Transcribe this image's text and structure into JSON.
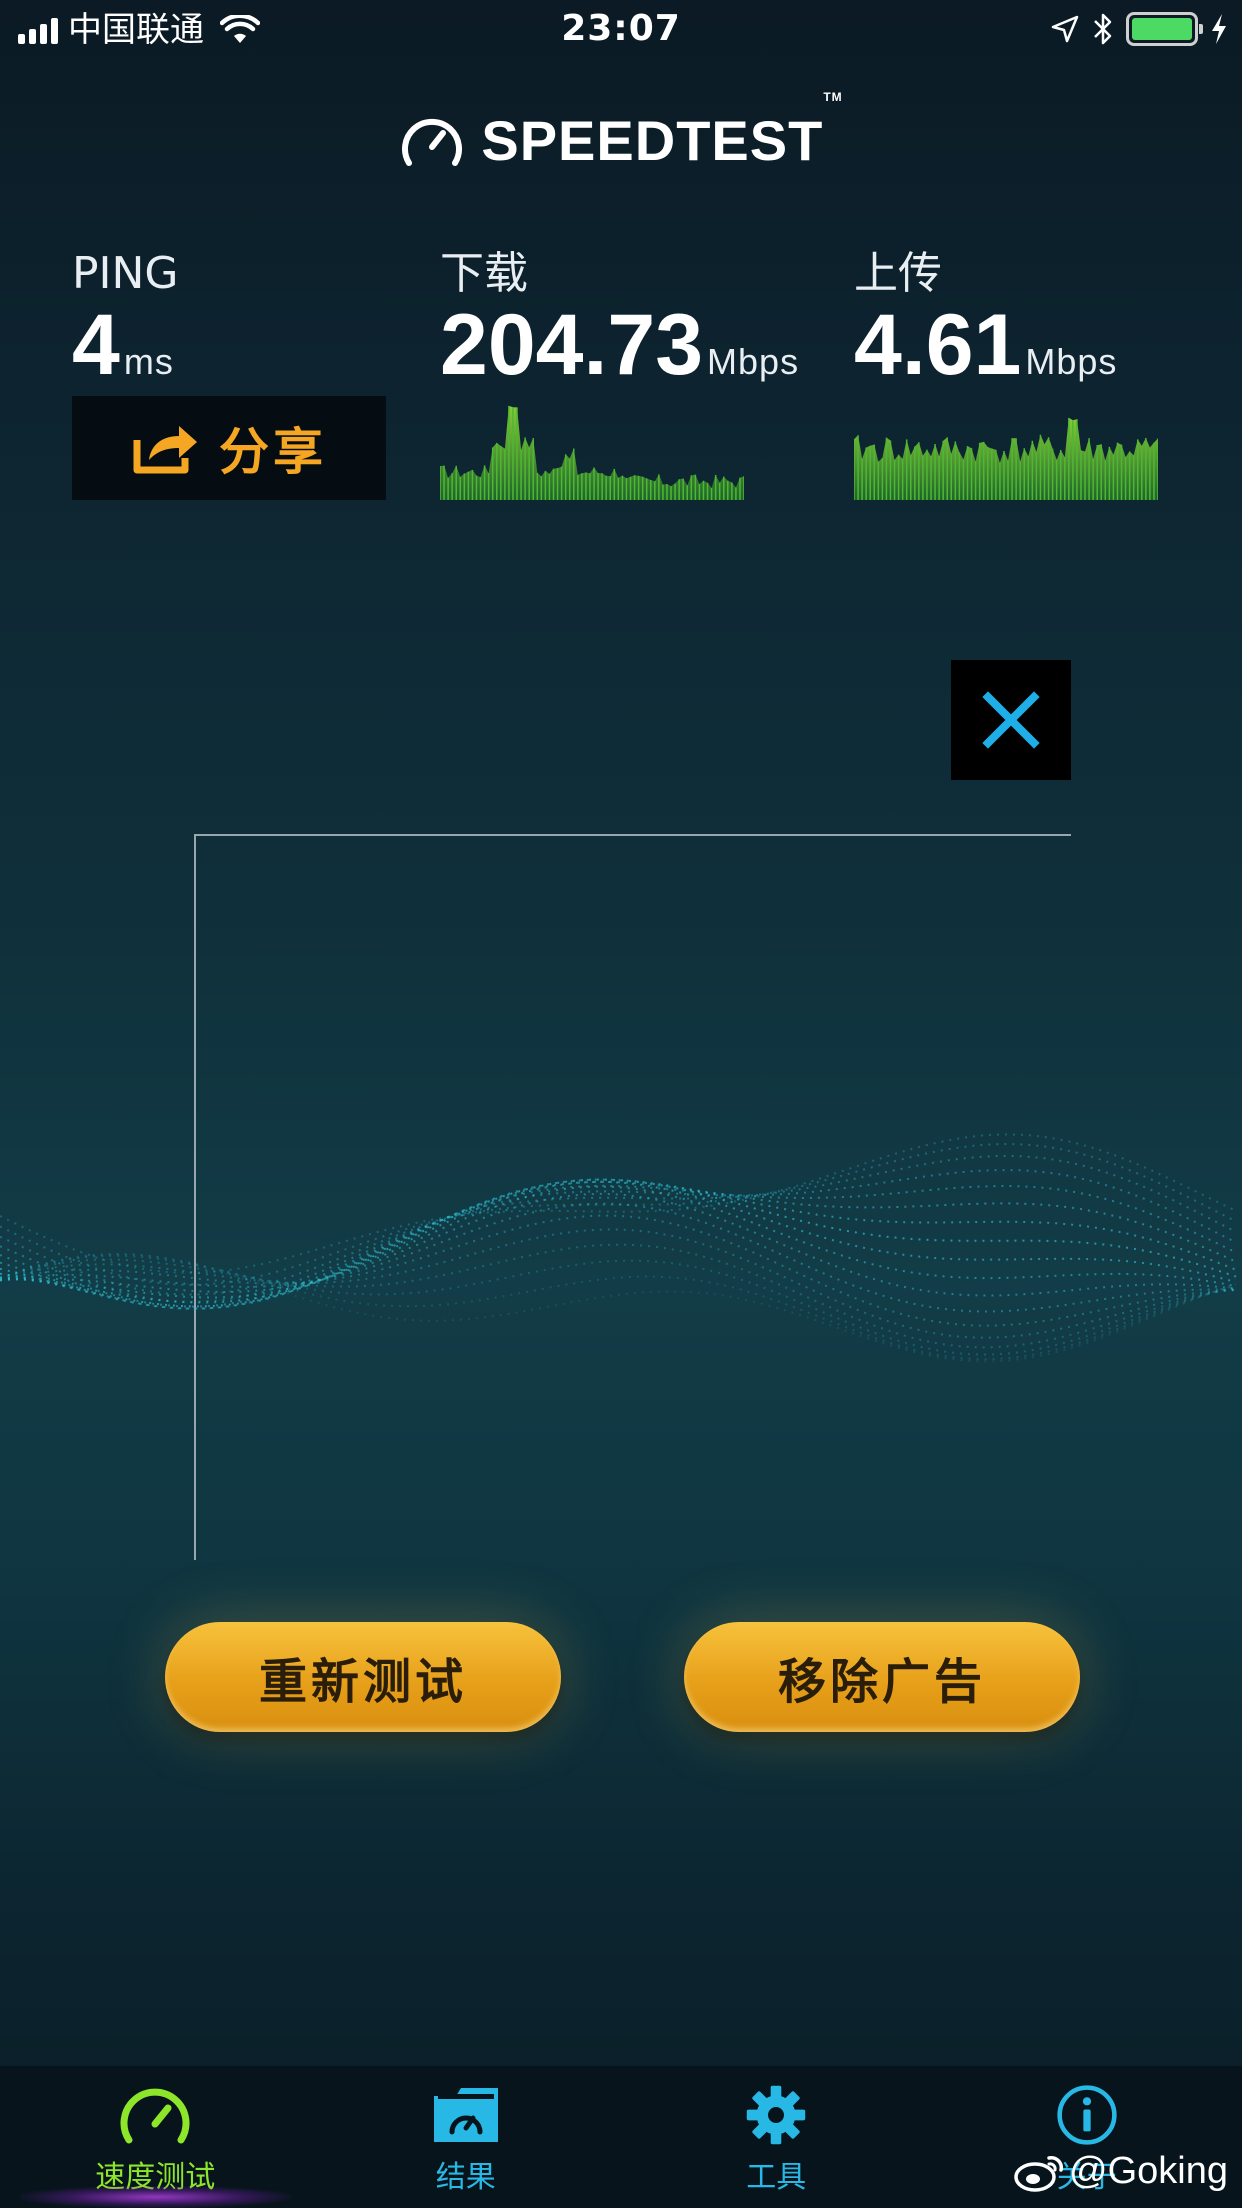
{
  "status_bar": {
    "carrier": "中国联通",
    "time": "23:07"
  },
  "brand": {
    "name": "SPEEDTEST",
    "trademark": "TM"
  },
  "metrics": {
    "ping": {
      "label": "PING",
      "value": "4",
      "unit": "ms"
    },
    "download": {
      "label": "下载",
      "value": "204.73",
      "unit": "Mbps"
    },
    "upload": {
      "label": "上传",
      "value": "4.61",
      "unit": "Mbps"
    }
  },
  "share_button": {
    "label": "分享"
  },
  "actions": {
    "retest_label": "重新测试",
    "remove_ads_label": "移除广告"
  },
  "tabs": [
    {
      "label": "速度测试",
      "icon": "speedometer-icon",
      "active": true
    },
    {
      "label": "结果",
      "icon": "results-folder-icon",
      "active": false
    },
    {
      "label": "工具",
      "icon": "gear-icon",
      "active": false
    },
    {
      "label": "关于",
      "icon": "info-icon",
      "active": false
    }
  ],
  "watermark": {
    "text": "@Goking"
  },
  "colors": {
    "accent_green": "#8ee62b",
    "accent_blue": "#28b8e6",
    "share_orange": "#f5a623",
    "button_gold": "#e7a01a"
  }
}
